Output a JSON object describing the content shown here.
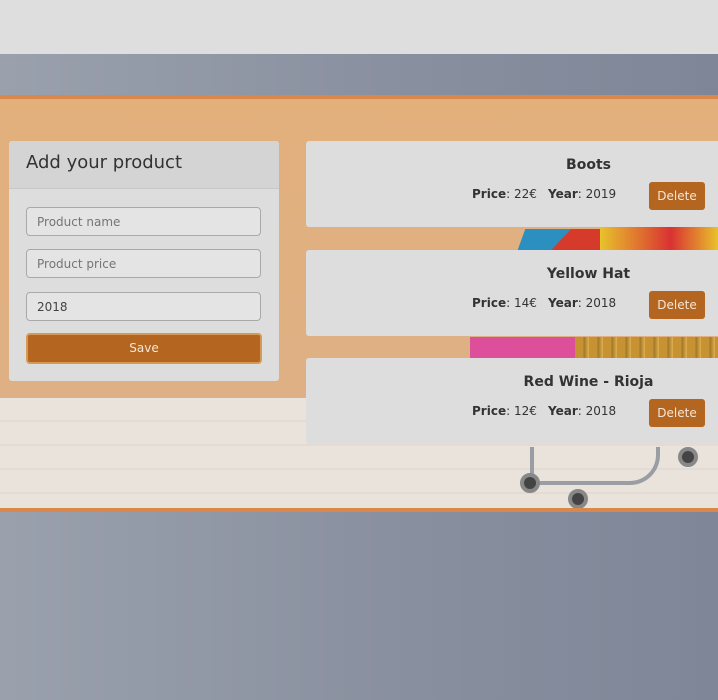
{
  "form": {
    "title": "Add your product",
    "name_placeholder": "Product name",
    "price_placeholder": "Product price",
    "year_value": "2018",
    "save_label": "Save"
  },
  "labels": {
    "price": "Price",
    "year": "Year",
    "delete": "Delete"
  },
  "products": [
    {
      "name": "Boots",
      "price": "22€",
      "year": "2019"
    },
    {
      "name": "Yellow Hat",
      "price": "14€",
      "year": "2018"
    },
    {
      "name": "Red Wine - Rioja",
      "price": "12€",
      "year": "2018"
    }
  ],
  "colors": {
    "accent": "#b4651f",
    "hero_border": "#d9874a"
  }
}
